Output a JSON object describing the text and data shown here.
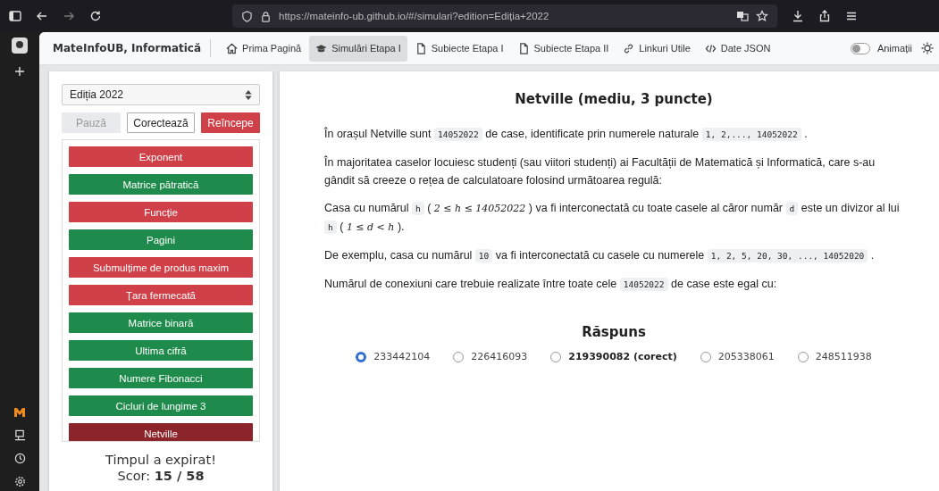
{
  "browser": {
    "url": "https://mateinfo-ub.github.io/#/simulari?edition=Ediția+2022"
  },
  "navbar": {
    "brand": "MateInfoUB, Informatică",
    "links": [
      {
        "label": "Prima Pagină",
        "kind": "home",
        "selected": false
      },
      {
        "label": "Simulări Etapa I",
        "kind": "simulation",
        "selected": true
      },
      {
        "label": "Subiecte Etapa I",
        "kind": "document",
        "selected": false
      },
      {
        "label": "Subiecte Etapa II",
        "kind": "document",
        "selected": false
      },
      {
        "label": "Linkuri Utile",
        "kind": "links",
        "selected": false
      },
      {
        "label": "Date JSON",
        "kind": "data",
        "selected": false
      }
    ],
    "toggle": {
      "label": "Animații",
      "on": false
    }
  },
  "panel": {
    "edition_select": "Ediția 2022",
    "buttons": [
      {
        "label": "Pauză",
        "kind": "light",
        "disabled": true
      },
      {
        "label": "Corectează",
        "kind": "outline",
        "disabled": false
      },
      {
        "label": "Reîncepe",
        "kind": "danger",
        "disabled": false
      }
    ],
    "problems": [
      {
        "label": "Exponent",
        "correct": false,
        "selected": false
      },
      {
        "label": "Matrice pătratică",
        "correct": true,
        "selected": false
      },
      {
        "label": "Funcție",
        "correct": false,
        "selected": false
      },
      {
        "label": "Pagini",
        "correct": true,
        "selected": false
      },
      {
        "label": "Submulțime de produs maxim",
        "correct": false,
        "selected": false
      },
      {
        "label": "Țara fermecată",
        "correct": false,
        "selected": false
      },
      {
        "label": "Matrice binară",
        "correct": true,
        "selected": false
      },
      {
        "label": "Ultima cifră",
        "correct": true,
        "selected": false
      },
      {
        "label": "Numere Fibonacci",
        "correct": true,
        "selected": false
      },
      {
        "label": "Cicluri de lungime 3",
        "correct": true,
        "selected": false
      },
      {
        "label": "Netville",
        "correct": false,
        "selected": true
      }
    ],
    "status": "Timpul a expirat!",
    "score_label": "Scor:",
    "score": "15 / 58"
  },
  "problem": {
    "title": "Netville (mediu, 3 puncte)",
    "paragraphs": [
      [
        {
          "kind": "text",
          "text": "În orașul Netville sunt"
        },
        {
          "kind": "code",
          "text": "14052022"
        },
        {
          "kind": "text",
          "text": "de case, identificate prin numerele naturale"
        },
        {
          "kind": "code",
          "text": "1, 2,..., 14052022"
        },
        {
          "kind": "text",
          "text": "."
        }
      ],
      [
        {
          "kind": "text",
          "text": "În majoritatea caselor locuiesc studenți (sau viitori studenți) ai Facultății de Matematică și Informatică, care s-au gândit să creeze o rețea de calculatoare folosind următoarea regulă:"
        }
      ],
      [
        {
          "kind": "text",
          "text": "Casa cu numărul"
        },
        {
          "kind": "code",
          "text": "h"
        },
        {
          "kind": "text",
          "text": "("
        },
        {
          "kind": "math",
          "text": "2 ≤ h ≤ 14052022"
        },
        {
          "kind": "text",
          "text": ") va fi interconectată cu toate casele al căror număr"
        },
        {
          "kind": "code",
          "text": "d"
        },
        {
          "kind": "text",
          "text": "este un divizor al lui"
        },
        {
          "kind": "code",
          "text": "h"
        },
        {
          "kind": "text",
          "text": "("
        },
        {
          "kind": "math",
          "text": "1 ≤ d < h"
        },
        {
          "kind": "text",
          "text": ")."
        }
      ],
      [
        {
          "kind": "text",
          "text": "De exemplu, casa cu numărul"
        },
        {
          "kind": "code",
          "text": "10"
        },
        {
          "kind": "text",
          "text": "va fi interconectată cu casele cu numerele"
        },
        {
          "kind": "code",
          "text": "1, 2, 5, 20, 30, ..., 14052020"
        },
        {
          "kind": "text",
          "text": "."
        }
      ],
      [
        {
          "kind": "text",
          "text": "Numărul de conexiuni care trebuie realizate între toate cele"
        },
        {
          "kind": "code",
          "text": "14052022"
        },
        {
          "kind": "text",
          "text": "de case este egal cu:"
        }
      ]
    ],
    "answer_title": "Răspuns",
    "options": [
      {
        "label": "233442104",
        "selected": true,
        "correct": false
      },
      {
        "label": "226416093",
        "selected": false,
        "correct": false
      },
      {
        "label": "219390082 (corect)",
        "selected": false,
        "correct": true
      },
      {
        "label": "205338061",
        "selected": false,
        "correct": false
      },
      {
        "label": "248511938",
        "selected": false,
        "correct": false
      }
    ]
  }
}
